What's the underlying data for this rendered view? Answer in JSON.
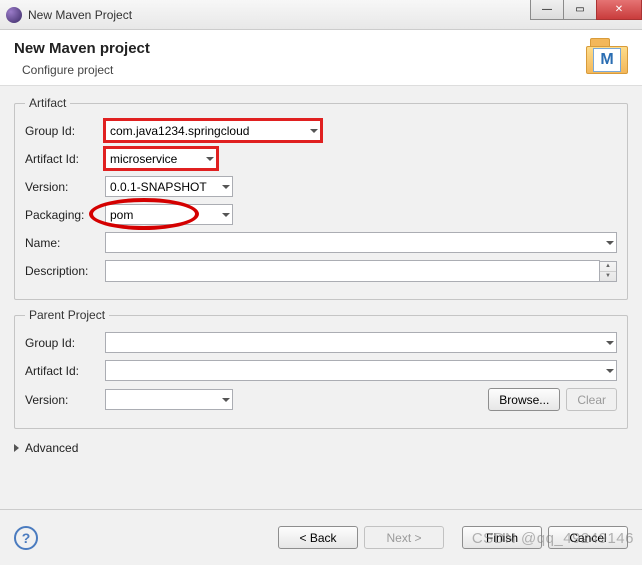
{
  "window": {
    "title": "New Maven Project"
  },
  "header": {
    "title": "New Maven project",
    "subtitle": "Configure project"
  },
  "artifact": {
    "legend": "Artifact",
    "group_id_label": "Group Id:",
    "group_id_value": "com.java1234.springcloud",
    "artifact_id_label": "Artifact Id:",
    "artifact_id_value": "microservice",
    "version_label": "Version:",
    "version_value": "0.0.1-SNAPSHOT",
    "packaging_label": "Packaging:",
    "packaging_value": "pom",
    "name_label": "Name:",
    "name_value": "",
    "description_label": "Description:",
    "description_value": ""
  },
  "parent": {
    "legend": "Parent Project",
    "group_id_label": "Group Id:",
    "group_id_value": "",
    "artifact_id_label": "Artifact Id:",
    "artifact_id_value": "",
    "version_label": "Version:",
    "version_value": "",
    "browse_label": "Browse...",
    "clear_label": "Clear"
  },
  "advanced_label": "Advanced",
  "footer": {
    "back": "< Back",
    "next": "Next >",
    "finish": "Finish",
    "cancel": "Cancel"
  },
  "watermark": "CSDN @qq_49249146",
  "m_letter": "M"
}
